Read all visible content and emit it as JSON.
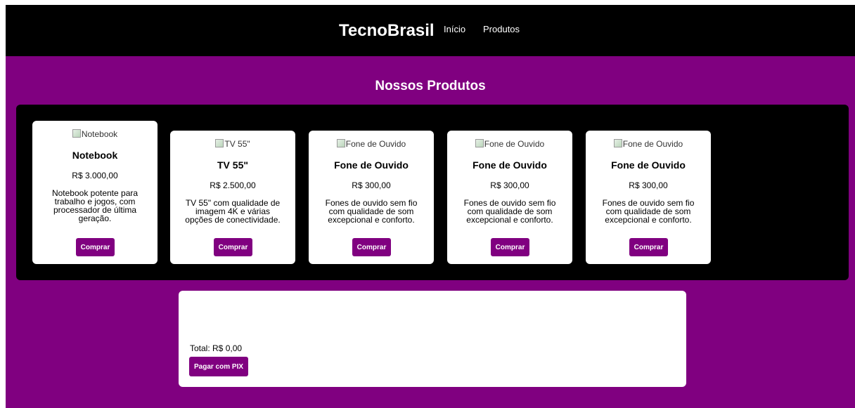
{
  "header": {
    "brand": "TecnoBrasil",
    "nav": [
      "Início",
      "Produtos"
    ]
  },
  "main": {
    "title": "Nossos Produtos"
  },
  "products": [
    {
      "image_alt": "Notebook",
      "name": "Notebook",
      "price": "R$ 3.000,00",
      "description": "Notebook potente para trabalho e jogos, com processador de última geração.",
      "button": "Comprar"
    },
    {
      "image_alt": "TV 55\"",
      "name": "TV 55\"",
      "price": "R$ 2.500,00",
      "description": "TV 55\" com qualidade de imagem 4K e várias opções de conectividade.",
      "button": "Comprar"
    },
    {
      "image_alt": "Fone de Ouvido",
      "name": "Fone de Ouvido",
      "price": "R$ 300,00",
      "description": "Fones de ouvido sem fio com qualidade de som excepcional e conforto.",
      "button": "Comprar"
    },
    {
      "image_alt": "Fone de Ouvido",
      "name": "Fone de Ouvido",
      "price": "R$ 300,00",
      "description": "Fones de ouvido sem fio com qualidade de som excepcional e conforto.",
      "button": "Comprar"
    },
    {
      "image_alt": "Fone de Ouvido",
      "name": "Fone de Ouvido",
      "price": "R$ 300,00",
      "description": "Fones de ouvido sem fio com qualidade de som excepcional e conforto.",
      "button": "Comprar"
    }
  ],
  "cart": {
    "total": "Total: R$ 0,00",
    "pay_button": "Pagar com PIX"
  },
  "colors": {
    "accent": "#800080",
    "header_bg": "#000000",
    "card_bg": "#ffffff"
  },
  "icons": {
    "broken_image": "broken-image-icon"
  }
}
